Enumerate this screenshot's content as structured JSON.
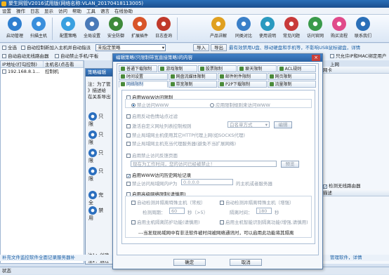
{
  "window": {
    "title": "聚生网管V2016试用版(网络名称:VLAN_20170418113005)"
  },
  "menu": [
    "设置",
    "操作",
    "日志",
    "显示",
    "访问",
    "帮助",
    "工具",
    "语言",
    "在线协助"
  ],
  "toolbar": {
    "buttons": [
      {
        "label": "启动管理"
      },
      {
        "label": "扫描主机"
      },
      {
        "label": "配置策略"
      },
      {
        "label": "全局设置"
      },
      {
        "label": "安全防御"
      },
      {
        "label": "扩展插件"
      },
      {
        "label": "日志查询"
      },
      {
        "label": "产品详解"
      },
      {
        "label": "同类对比"
      },
      {
        "label": "使用说明"
      },
      {
        "label": "常见问题"
      },
      {
        "label": "访问官网"
      },
      {
        "label": "购买流程"
      },
      {
        "label": "联系我们"
      }
    ]
  },
  "options": {
    "select_all": "全选",
    "auto_control_new": "自动控制新加入主机并自动指派",
    "dropdown": "未指定策略",
    "import": "导入",
    "export": "导出",
    "marquee": "最有效禁用U盘、移动硬盘和手机等，不影响USB鼠标键盘，详情",
    "auto_start": "自动启动无线路由器",
    "auto_ip": "自动禁止手机/平板",
    "auto_mac": "只允许IP和MAC绑定用户上网"
  },
  "hosts_table": {
    "headers": [
      "IP地址(打勾控制)",
      "主机名(点击看"
    ],
    "rows": [
      [
        "192.168.8.1...",
        "控制机"
      ]
    ]
  },
  "right_pane": {
    "header": "网卡",
    "detect_wireless": "检测无线路由器",
    "desc_header": "描述"
  },
  "back_dialog": {
    "title": "策略编辑",
    "note_lines": [
      "注：为了管",
      "》描述给",
      "在关系导出"
    ],
    "side_items": [
      "只限",
      "只限",
      "只限",
      "只限",
      "完全",
      "禁用"
    ],
    "footer_lines": [
      "注1：创建",
      "注2：通过"
    ]
  },
  "dialog": {
    "title": "编辑策略(只限制带宽直接策略)的内容",
    "tabs_row1": [
      "普通下载限制",
      "游戏限制",
      "股票限制",
      "聊天限制",
      "ACL规则"
    ],
    "tabs_row2": [
      "时间设置",
      "网盘流媒体限制",
      "邮件附件限制",
      "网页限制"
    ],
    "tabs_row3": [
      "网络限制",
      "带宽限制",
      "P2P下载限制",
      "流量限制"
    ],
    "panel": {
      "enable_www": "启用WWW访问限制",
      "radio_block_all": "禁止访问WWW",
      "radio_allow_list": "应用限制规则来访问WWW",
      "enable_url_filter": "启用反动色情站点过滤",
      "custom_url_rules": "激活自定义网址列表控制规则",
      "whitelist_select": "白名单方式",
      "edit_button": "编辑",
      "block_https": "禁止局域网主机使用其它HTTP代理上网(如SOCKS代理)",
      "block_proxy_server": "禁止局域网主机充当代理服务器(避免不当扩展网络)",
      "enable_feedback_page": "启用禁止访问反馈页面",
      "feedback_text": "现在为工作时间，您的访问已经被禁止！",
      "preview_button": "预览",
      "enable_record": "启用WWW访问历史网址记录",
      "block_ip_label": "禁止访问局域网内IP为",
      "block_ip_value": "0.0.0.0",
      "block_ip_suffix": "的主机或者服务器",
      "enable_advanced": "启用高级网络限制(请慎用)",
      "auto_isolate_normal": "自动检测并隔离特殊主机（常规）",
      "auto_isolate_enhanced": "自动检测并隔离特殊主机（增强）",
      "detect_period_label": "检测周期：",
      "detect_period_value": "60",
      "detect_period_unit": "秒（>5）",
      "isolate_time_label": "隔离时间：",
      "isolate_time_value": "180",
      "isolate_time_unit": "秒",
      "enable_host_isolation": "启用主机隔离防护功能(请慎用)",
      "enable_host_isolation2": "启用主机智能识别隔离功能(增强,请慎用)",
      "footnote": "---当发现局域网中有非法软件被时间被网络通讯时，可以启用此功能将其隔离"
    },
    "ok_button": "确定",
    "cancel_button": "取消"
  },
  "bluebar": "补充文件监控软件全面记录服务器补",
  "bluebar_right": "管理软件，详情",
  "status": "状态"
}
